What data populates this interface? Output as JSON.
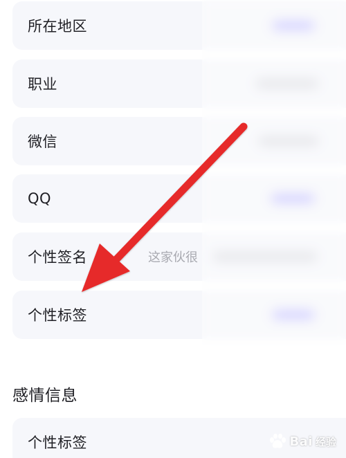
{
  "profile_rows": [
    {
      "label": "所在地区"
    },
    {
      "label": "职业"
    },
    {
      "label": "微信"
    },
    {
      "label": "QQ"
    },
    {
      "label": "个性签名",
      "value_hint": "这家伙很"
    },
    {
      "label": "个性标签"
    }
  ],
  "section": {
    "title": "感情信息"
  },
  "section_rows": [
    {
      "label": "个性标签"
    }
  ],
  "annotation": {
    "arrow_color": "#e62a2a",
    "arrow_target": "个性标签"
  },
  "watermark": {
    "text": "Bai",
    "sub_text": "经验",
    "icon": "baidu-paw-icon"
  },
  "colors": {
    "row_background": "#f6f7fb",
    "label_text": "#1f1f24",
    "hint_text": "#a8a9b0",
    "value_accent": "#b9b5ff"
  }
}
